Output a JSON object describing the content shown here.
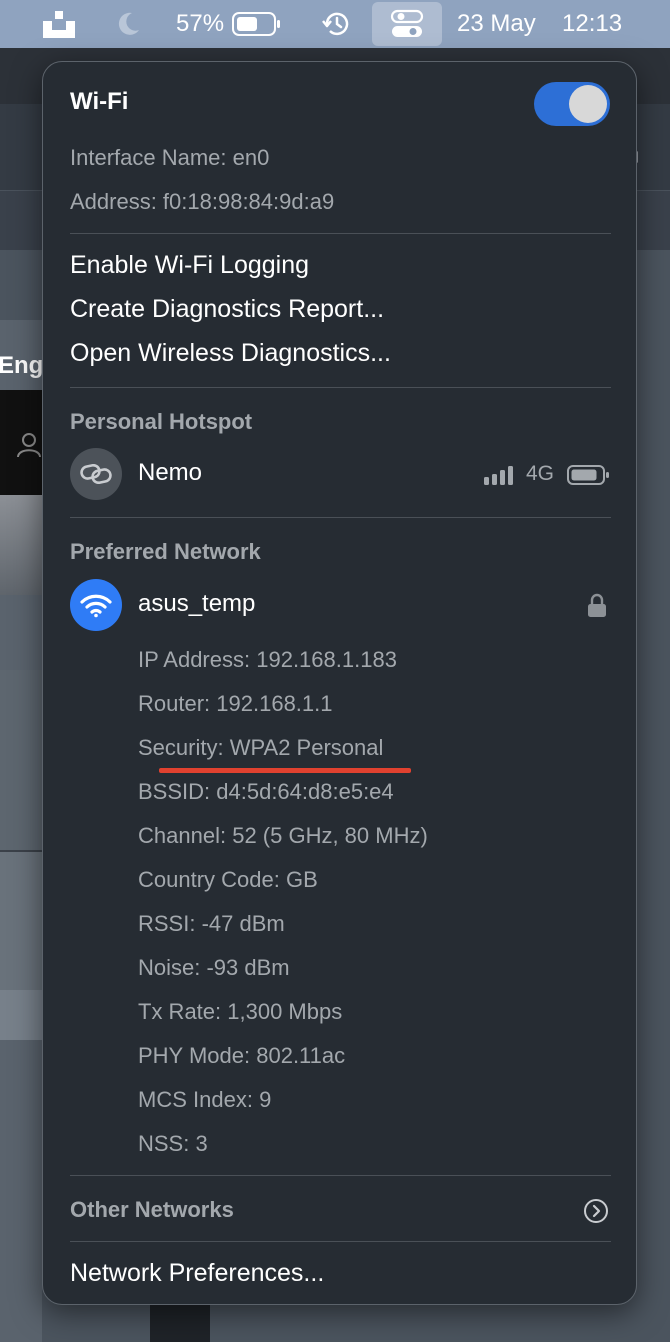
{
  "menubar": {
    "battery_percent": "57%",
    "date": "23 May",
    "time": "12:13",
    "icons": [
      "app-status-icon",
      "moon-icon",
      "battery-icon",
      "time-machine-icon",
      "control-center-icon"
    ]
  },
  "wifi": {
    "title": "Wi-Fi",
    "toggle_on": true,
    "interface_name": "Interface Name: en0",
    "address": "Address: f0:18:98:84:9d:a9",
    "actions": [
      "Enable Wi-Fi Logging",
      "Create Diagnostics Report...",
      "Open Wireless Diagnostics..."
    ]
  },
  "hotspot": {
    "section_label": "Personal Hotspot",
    "name": "Nemo",
    "network_type": "4G"
  },
  "preferred": {
    "section_label": "Preferred Network",
    "name": "asus_temp",
    "details": [
      {
        "label": "IP Address:",
        "value": "192.168.1.183"
      },
      {
        "label": "Router:",
        "value": "192.168.1.1"
      },
      {
        "label": "Security:",
        "value": "WPA2 Personal"
      },
      {
        "label": "BSSID:",
        "value": "d4:5d:64:d8:e5:e4"
      },
      {
        "label": "Channel:",
        "value": "52 (5 GHz, 80 MHz)"
      },
      {
        "label": "Country Code:",
        "value": "GB"
      },
      {
        "label": "RSSI:",
        "value": "-47 dBm"
      },
      {
        "label": "Noise:",
        "value": "-93 dBm"
      },
      {
        "label": "Tx Rate:",
        "value": "1,300 Mbps"
      },
      {
        "label": "PHY Mode:",
        "value": "802.11ac"
      },
      {
        "label": "MCS Index:",
        "value": "9"
      },
      {
        "label": "NSS:",
        "value": "3"
      }
    ]
  },
  "other_networks": "Other Networks",
  "network_preferences": "Network Preferences...",
  "background": {
    "partial_text": "Engl"
  },
  "colors": {
    "accent": "#2d6fd6",
    "highlight_underline": "#e0412f",
    "menubar": "#8fa3bf",
    "panel": "#262c33"
  }
}
